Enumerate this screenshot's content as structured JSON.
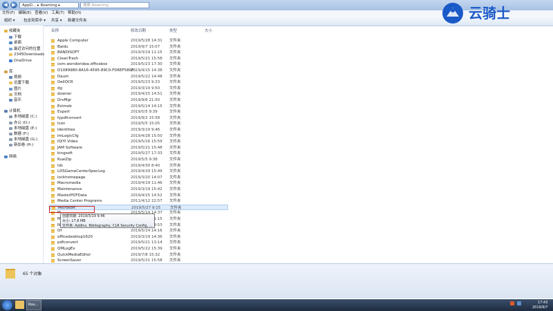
{
  "window": {
    "address": "AppD... ▸ Roaming ▸",
    "search_placeholder": "搜索 Roaming"
  },
  "menu": [
    "文件(F)",
    "编辑(E)",
    "查看(V)",
    "工具(T)",
    "帮助(H)"
  ],
  "toolbar": {
    "organize": "组织 ▾",
    "include": "包含到库中 ▾",
    "share": "共享 ▾",
    "new_folder": "新建文件夹"
  },
  "columns": {
    "name": "名称",
    "date": "修改日期",
    "type": "类型",
    "size": "大小"
  },
  "sidebar": [
    {
      "label": "收藏夹",
      "icon": "star-icon",
      "color": "#e5b43a"
    },
    {
      "label": "下载",
      "icon": "download-folder-icon",
      "color": "#6a8fc8"
    },
    {
      "label": "桌面",
      "icon": "desktop-icon",
      "color": "#4a86c8"
    },
    {
      "label": "最近访问的位置",
      "icon": "recent-icon",
      "color": "#7da3cf"
    },
    {
      "label": "2345Downloads",
      "icon": "folder-icon",
      "color": "#eec45a"
    },
    {
      "label": "OneDrive",
      "icon": "cloud-icon",
      "color": "#3d7fd6"
    },
    {
      "label": "库",
      "icon": "library-icon",
      "color": "#d2a04a"
    },
    {
      "label": "视频",
      "icon": "video-icon",
      "color": "#5e86b8"
    },
    {
      "label": "迅雷下载",
      "icon": "folder-icon",
      "color": "#eec45a"
    },
    {
      "label": "图片",
      "icon": "pictures-icon",
      "color": "#6b9bd1"
    },
    {
      "label": "文档",
      "icon": "documents-icon",
      "color": "#c9b27a"
    },
    {
      "label": "音乐",
      "icon": "music-icon",
      "color": "#5e86b8"
    },
    {
      "label": "计算机",
      "icon": "computer-icon",
      "color": "#5b7fae"
    },
    {
      "label": "本地磁盘 (C:)",
      "icon": "drive-icon",
      "color": "#8a9bb0"
    },
    {
      "label": "办公 (D:)",
      "icon": "drive-icon",
      "color": "#8a9bb0"
    },
    {
      "label": "本地磁盘 (E:)",
      "icon": "drive-icon",
      "color": "#8a9bb0"
    },
    {
      "label": "数据 (F:)",
      "icon": "drive-icon",
      "color": "#8a9bb0"
    },
    {
      "label": "本地磁盘 (G:)",
      "icon": "drive-icon",
      "color": "#8a9bb0"
    },
    {
      "label": "新加卷 (H:)",
      "icon": "drive-icon",
      "color": "#8a9bb0"
    },
    {
      "label": "网络",
      "icon": "network-icon",
      "color": "#4a86c8"
    }
  ],
  "files": [
    {
      "name": "Apple Computer",
      "date": "2019/5/28 14:31",
      "type": "文件夹"
    },
    {
      "name": "Baidu",
      "date": "2019/9/7 15:07",
      "type": "文件夹"
    },
    {
      "name": "BANDISOFT",
      "date": "2019/3/19 11:15",
      "type": "文件夹"
    },
    {
      "name": "CleanTrash",
      "date": "2019/5/21 15:58",
      "type": "文件夹"
    },
    {
      "name": "com.wonderidea.officebox",
      "date": "2019/5/23 17:30",
      "type": "文件夹"
    },
    {
      "name": "D1089980-8A16-4595-89C0-FD6EF580F...",
      "date": "2019/4/15 14:38",
      "type": "文件夹"
    },
    {
      "name": "Daum",
      "date": "2019/5/22 14:48",
      "type": "文件夹"
    },
    {
      "name": "DeliOCR",
      "date": "2019/5/23 9:33",
      "type": "文件夹"
    },
    {
      "name": "dg",
      "date": "2019/3/19 9:50",
      "type": "文件夹"
    },
    {
      "name": "downer",
      "date": "2019/4/15 14:51",
      "type": "文件夹"
    },
    {
      "name": "DrvMgr",
      "date": "2019/9/6 21:50",
      "type": "文件夹"
    },
    {
      "name": "Estmob",
      "date": "2019/5/14 14:15",
      "type": "文件夹"
    },
    {
      "name": "Expert",
      "date": "2019/5/5 9:39",
      "type": "文件夹"
    },
    {
      "name": "fypdfconvert",
      "date": "2019/9/2 15:58",
      "type": "文件夹"
    },
    {
      "name": "Icon",
      "date": "2019/5/5 15:05",
      "type": "文件夹"
    },
    {
      "name": "Identities",
      "date": "2019/3/19 9:46",
      "type": "文件夹"
    },
    {
      "name": "ImLogicCfg",
      "date": "2019/4/28 15:50",
      "type": "文件夹"
    },
    {
      "name": "IQIYI Video",
      "date": "2019/5/16 15:59",
      "type": "文件夹"
    },
    {
      "name": "JAM Software",
      "date": "2019/5/21 15:48",
      "type": "文件夹"
    },
    {
      "name": "kingsoft",
      "date": "2019/5/27 17:33",
      "type": "文件夹"
    },
    {
      "name": "KuaiZip",
      "date": "2019/5/5 9:38",
      "type": "文件夹"
    },
    {
      "name": "lds",
      "date": "2019/4/30 8:40",
      "type": "文件夹"
    },
    {
      "name": "LDSGameCenterSpecLog",
      "date": "2019/4/29 15:49",
      "type": "文件夹"
    },
    {
      "name": "lockhomepage",
      "date": "2019/3/20 14:07",
      "type": "文件夹"
    },
    {
      "name": "Macromedia",
      "date": "2019/4/19 11:46",
      "type": "文件夹"
    },
    {
      "name": "Maintenance",
      "date": "2019/3/19 15:42",
      "type": "文件夹"
    },
    {
      "name": "MasterPDFData",
      "date": "2019/4/15 14:52",
      "type": "文件夹"
    },
    {
      "name": "Media Center Programs",
      "date": "2011/4/12 22:57",
      "type": "文件夹"
    },
    {
      "name": "Microsoft",
      "date": "2019/5/27 9:15",
      "type": "文件夹",
      "highlighted": true
    },
    {
      "name": "M",
      "date": "2019/5/14 14:37",
      "type": "文件夹"
    },
    {
      "name": "M",
      "date": "2019/3/19 11:15",
      "type": "文件夹"
    },
    {
      "name": "Ni",
      "date": "2019/5/14 14:53",
      "type": "文件夹"
    },
    {
      "name": "Of",
      "date": "2019/5/14 14:16",
      "type": "文件夹"
    },
    {
      "name": "officedesktop1620",
      "date": "2019/3/19 14:36",
      "type": "文件夹"
    },
    {
      "name": "pdfconvert",
      "date": "2019/5/21 13:14",
      "type": "文件夹"
    },
    {
      "name": "QMLogEx",
      "date": "2019/5/22 15:39",
      "type": "文件夹"
    },
    {
      "name": "QuickMediaEditor",
      "date": "2019/7/8 15:32",
      "type": "文件夹"
    },
    {
      "name": "ScreenSaver",
      "date": "2019/5/21 15:58",
      "type": "文件夹"
    },
    {
      "name": "Send Anywhere",
      "date": "2019/5/14 14:28",
      "type": "文件夹"
    },
    {
      "name": "Tencent",
      "date": "2019/5/22 15:39",
      "type": "文件夹"
    },
    {
      "name": "thunderx",
      "date": "2019/5/4 9:40",
      "type": "文件夹"
    }
  ],
  "tooltip": {
    "line1": "创建日期: 2019/3/19 9:46",
    "line2": "大小: 17.8 MB",
    "line3": "文件夹: AddIns, Bibliography, CLR Security Config, ..."
  },
  "status": {
    "count": "65 个对象"
  },
  "taskbar": {
    "window_label": "Roa...",
    "time": "17:43",
    "date": "2019/9/7"
  },
  "watermark": {
    "text": "云骑士"
  }
}
